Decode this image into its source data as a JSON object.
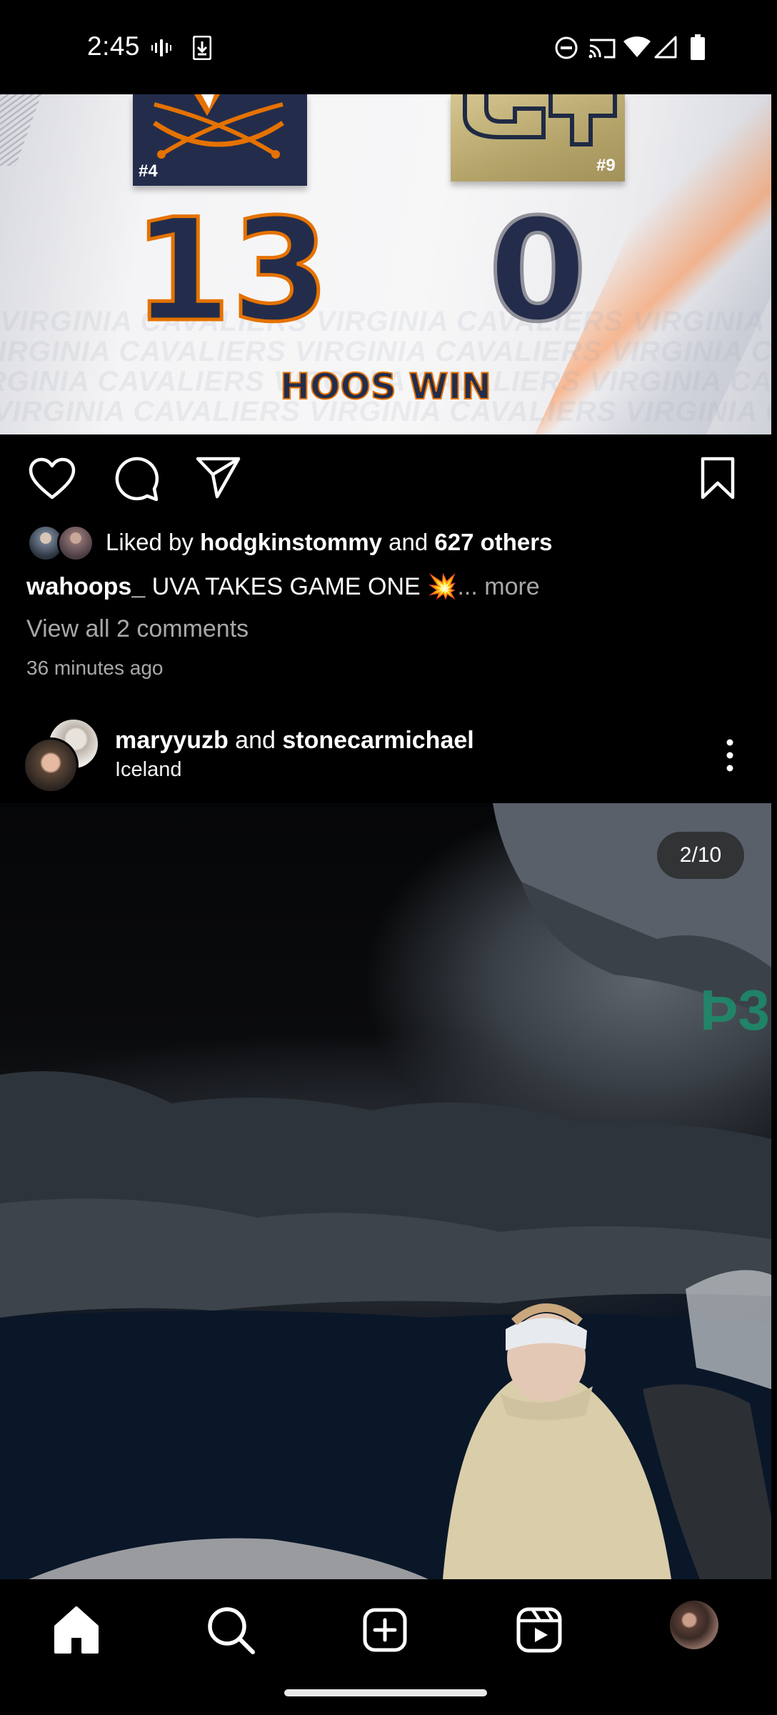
{
  "status_bar": {
    "time": "2:45",
    "icons": [
      "vibrate-icon",
      "download-icon",
      "do-not-disturb-icon",
      "cast-icon",
      "wifi-icon",
      "signal-icon",
      "battery-icon"
    ]
  },
  "post1": {
    "image": {
      "home_rank": "#4",
      "away_rank": "#9",
      "home_score": "13",
      "away_score": "0",
      "result": "HOOS WIN",
      "wordmark": "VIRGINIA CAVALIERS VIRGINIA CAVALIERS VIRGINIA CAVALIERS VIRGINIA"
    },
    "actions": [
      "like-icon",
      "comment-icon",
      "share-icon",
      "save-icon"
    ],
    "liked_prefix": "Liked by ",
    "liked_user": "hodgkinstommy",
    "liked_mid": " and ",
    "liked_count": "627 others",
    "caption_user": "wahoops_",
    "caption_text": " UVA TAKES GAME ONE 💥",
    "caption_more": "... more",
    "view_comments": "View all 2 comments",
    "time_ago": "36 minutes ago"
  },
  "post2": {
    "author1": "maryyuzb",
    "joiner": " and ",
    "author2": "stonecarmichael",
    "location": "Iceland",
    "counter": "2/10",
    "rock_text": "Þ3"
  },
  "nav": [
    "home-icon",
    "search-icon",
    "create-icon",
    "reels-icon",
    "profile-avatar"
  ],
  "colors": {
    "uva_navy": "#232d4b",
    "uva_orange": "#e57200",
    "gt_gold": "#b3a369",
    "muted_text": "#a8a8a8"
  }
}
